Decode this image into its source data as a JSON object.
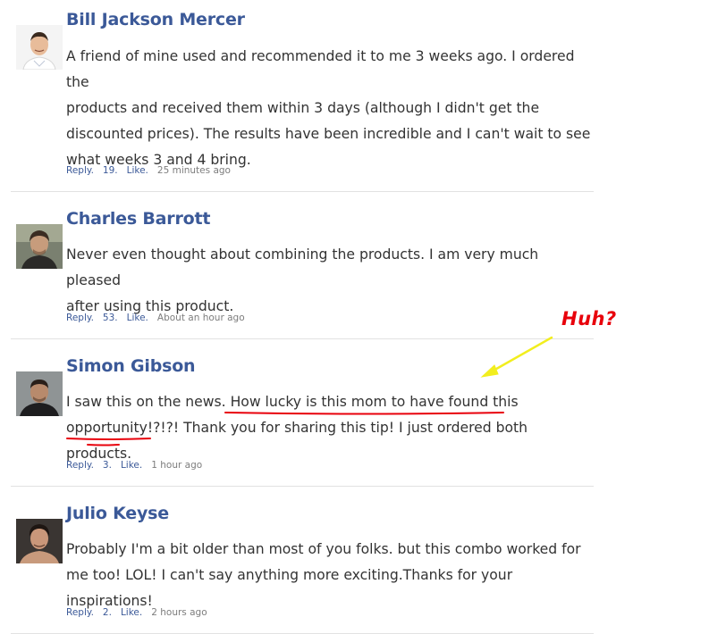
{
  "comments": [
    {
      "name": "Bill Jackson Mercer",
      "lines": [
        "A friend of mine used and recommended it to me 3 weeks ago. I ordered the",
        "products and received them within 3 days (although I didn't get the",
        "discounted prices). The results have been incredible and I can't wait to see",
        "what weeks 3 and 4 bring."
      ],
      "reply": "Reply.",
      "count": "19.",
      "like": "Like.",
      "time": "25 minutes ago"
    },
    {
      "name": "Charles Barrott",
      "lines": [
        "Never even thought about combining the products. I am very much pleased",
        "after using this product."
      ],
      "reply": "Reply.",
      "count": "53.",
      "like": "Like.",
      "time": "About an hour ago"
    },
    {
      "name": "Simon Gibson",
      "line1_prefix": "I saw this on the news. ",
      "line1_highlight": "How lucky is this mom to have found this",
      "line2_highlight": "opportunity!?!?!",
      "line2_suffix": " Thank you for sharing this tip! I just ordered both products.",
      "reply": "Reply.",
      "count": "3.",
      "like": "Like.",
      "time": "1 hour ago"
    },
    {
      "name": "Julio Keyse",
      "lines": [
        "Probably I'm a bit older than most of you folks. but this combo worked for",
        "me too! LOL! I can't say anything more exciting.Thanks for your inspirations!"
      ],
      "reply": "Reply.",
      "count": "2.",
      "like": "Like.",
      "time": "2 hours ago"
    }
  ],
  "annotation": {
    "label": "Huh?",
    "color": "#e8000b",
    "arrow_color": "#f2ee1e",
    "underline_color": "#e8000b"
  },
  "colors": {
    "name": "#3b5998",
    "text": "#333333",
    "meta_link": "#3b5998",
    "meta_time": "#7d7d7d",
    "divider": "#e2e2e2"
  }
}
